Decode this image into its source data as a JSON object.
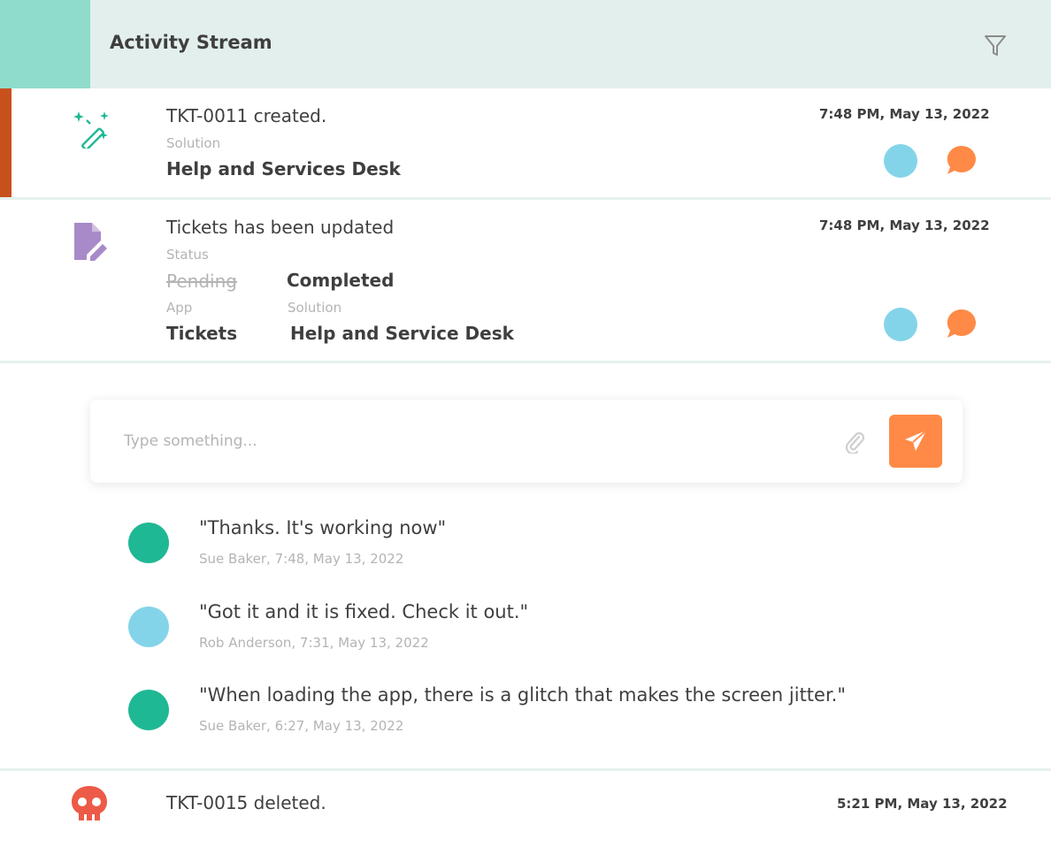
{
  "header": {
    "title": "Activity Stream",
    "filter_icon": "filter-icon"
  },
  "entries": [
    {
      "icon": "magic-wand-icon",
      "title": "TKT-0011 created.",
      "timestamp": "7:48 PM, May 13, 2022",
      "fields": [
        {
          "label": "Solution",
          "value": "Help and Services Desk"
        }
      ]
    },
    {
      "icon": "edit-document-icon",
      "title": "Tickets has been updated",
      "timestamp": "7:48 PM, May 13, 2022",
      "status": {
        "label": "Status",
        "old_value": "Pending",
        "new_value": "Completed"
      },
      "fields": [
        {
          "label": "App",
          "value": "Tickets"
        },
        {
          "label": "Solution",
          "value": "Help and Service Desk"
        }
      ]
    },
    {
      "icon": "skull-icon",
      "title": "TKT-0015 deleted.",
      "timestamp": "5:21 PM, May 13, 2022"
    }
  ],
  "composer": {
    "placeholder": "Type something...",
    "attach_icon": "paperclip-icon",
    "send_icon": "send-icon"
  },
  "comments": [
    {
      "text": "\"Thanks. It's working now\"",
      "meta": "Sue Baker, 7:48, May 13, 2022",
      "avatar_color": "#1fb894"
    },
    {
      "text": "\"Got it and it is fixed. Check it out.\"",
      "meta": "Rob Anderson, 7:31, May 13, 2022",
      "avatar_color": "#84d4e9"
    },
    {
      "text": "\"When loading the app, there is a glitch that makes the screen jitter.\"",
      "meta": "Sue Baker, 6:27, May 13, 2022",
      "avatar_color": "#1fb894"
    }
  ],
  "colors": {
    "header_bg": "#e3efec",
    "header_accent": "#8fdccb",
    "created_marker": "#c8501c",
    "send_button": "#ff8a47",
    "chat_icon": "#ff8a47",
    "user_blue": "#84d4e9",
    "user_green": "#1fb894",
    "wand_icon": "#1fb894",
    "edit_icon": "#a88ac9",
    "skull_icon": "#ed5a47"
  }
}
